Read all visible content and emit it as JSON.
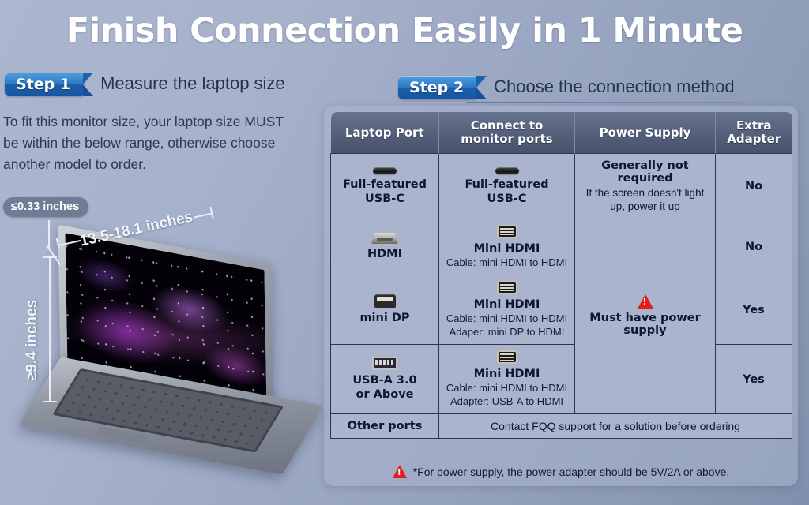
{
  "title": "Finish Connection Easily in 1 Minute",
  "step1": {
    "badge": "Step 1",
    "heading": "Measure the laptop size",
    "intro": "To fit this monitor size, your laptop size MUST be within the below range, otherwise choose another model to order.",
    "dimensions": {
      "thickness": "≤0.33 inches",
      "width": "13.5-18.1 inches",
      "height": "≥9.4 inches"
    }
  },
  "step2": {
    "badge": "Step 2",
    "heading": "Choose the connection method"
  },
  "table": {
    "headers": [
      "Laptop Port",
      "Connect to\nmonitor ports",
      "Power Supply",
      "Extra\nAdapter"
    ],
    "headers_flat": {
      "port": "Laptop Port",
      "connect_line1": "Connect to",
      "connect_line2": "monitor ports",
      "power": "Power Supply",
      "extra_line1": "Extra",
      "extra_line2": "Adapter"
    },
    "rows": [
      {
        "port_icon": "usb-c-icon",
        "port_label_line1": "Full-featured",
        "port_label_line2": "USB-C",
        "connect_icon": "usb-c-icon",
        "connect_label_line1": "Full-featured",
        "connect_label_line2": "USB-C",
        "connect_note1": "",
        "connect_note2": "",
        "power_title": "Generally not required",
        "power_sub": "If the screen doesn't light up, power it up",
        "extra": "No"
      },
      {
        "port_icon": "hdmi-icon",
        "port_label_line1": "HDMI",
        "port_label_line2": "",
        "connect_icon": "mini-hdmi-icon",
        "connect_label_line1": "Mini HDMI",
        "connect_label_line2": "",
        "connect_note1": "Cable: mini HDMI to HDMI",
        "connect_note2": "",
        "extra": "No"
      },
      {
        "port_icon": "mini-dp-icon",
        "port_label_line1": "mini DP",
        "port_label_line2": "",
        "connect_icon": "mini-hdmi-icon",
        "connect_label_line1": "Mini HDMI",
        "connect_label_line2": "",
        "connect_note1": "Cable: mini HDMI to HDMI",
        "connect_note2": "Adaper: mini DP to HDMI",
        "extra": "Yes"
      },
      {
        "port_icon": "usb-a-icon",
        "port_label_line1": "USB-A 3.0",
        "port_label_line2": "or Above",
        "connect_icon": "mini-hdmi-icon",
        "connect_label_line1": "Mini HDMI",
        "connect_label_line2": "",
        "connect_note1": "Cable: mini HDMI to HDMI",
        "connect_note2": "Adapter: USB-A to HDMI",
        "extra": "Yes"
      }
    ],
    "power_merged": {
      "warning_icon": "warning-triangle-icon",
      "text_line1": "Must have power",
      "text_line2": "supply"
    },
    "other_row": {
      "label": "Other ports",
      "note": "Contact FQQ support for a solution before ordering"
    },
    "footnote": {
      "icon": "warning-triangle-icon",
      "text": "*For power supply, the power adapter should be 5V/2A or above."
    }
  },
  "colors": {
    "title_text": "#ffffff",
    "badge_blue": "#1c5ea8",
    "table_header": "#54607a",
    "cell_bg": "#aab5cd",
    "cell_border": "#2b3752",
    "warning_red": "#e41f17",
    "body_text": "#131c36"
  }
}
